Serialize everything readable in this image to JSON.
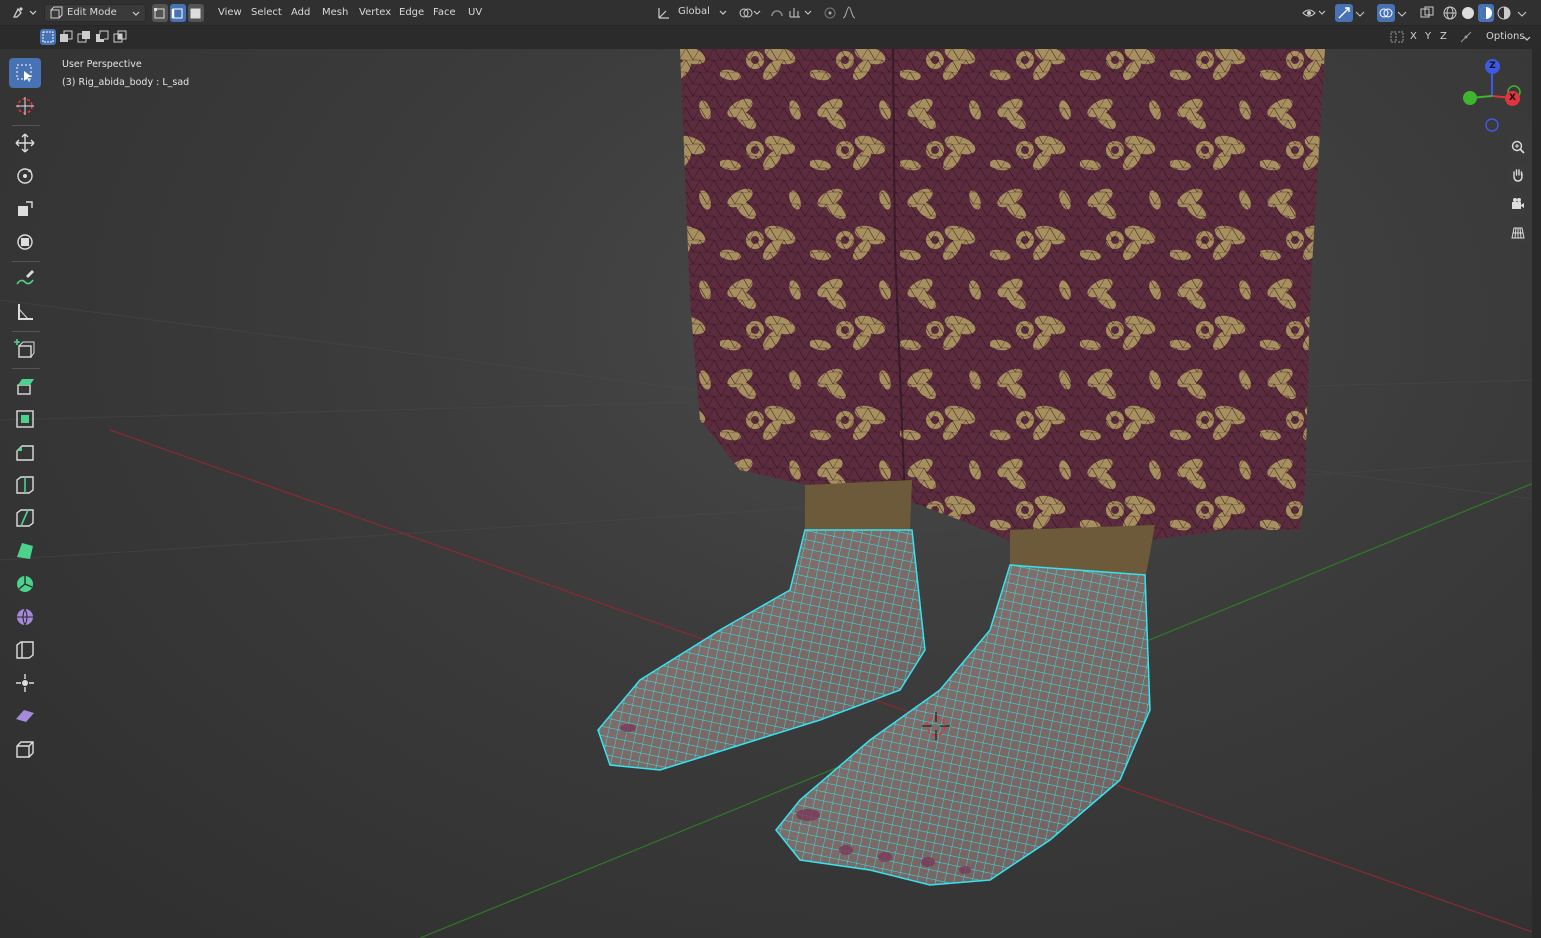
{
  "header": {
    "mode_label": "Edit Mode",
    "menus": [
      "View",
      "Select",
      "Add",
      "Mesh",
      "Vertex",
      "Edge",
      "Face",
      "UV"
    ],
    "transform_orientation": "Global",
    "select_mode_active": "edge"
  },
  "subheader": {
    "axis_labels": [
      "X",
      "Y",
      "Z"
    ],
    "options_label": "Options"
  },
  "viewport": {
    "view_name": "User Perspective",
    "object_info": "(3) Rig_abida_body : L_sad"
  },
  "gizmo": {
    "z_label": "Z",
    "x_label": "X"
  },
  "toolbar": {
    "active_tool": "select-box",
    "tools": [
      "select-box",
      "cursor",
      "move",
      "rotate",
      "scale",
      "transform",
      "annotate",
      "measure",
      "add-cube",
      "extrude",
      "inset",
      "bevel",
      "loop-cut",
      "knife",
      "poly-build",
      "spin",
      "smooth",
      "edge-slide",
      "shrink-fatten",
      "shear",
      "rip"
    ]
  },
  "colors": {
    "accent": "#4772b3",
    "wire_selected": "#34e4f0",
    "x_axis": "#e0343e",
    "y_axis": "#3fb52f",
    "z_axis": "#3d5be2",
    "fabric_base": "#5c2c3e",
    "fabric_pattern": "#a88f5f"
  }
}
